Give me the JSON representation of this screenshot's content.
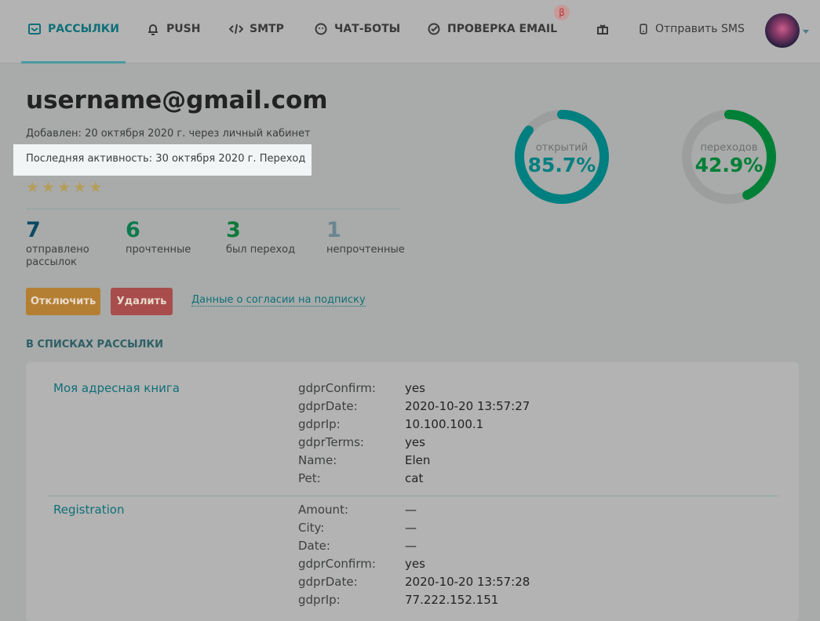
{
  "nav": {
    "items": [
      {
        "label": "РАССЫЛКИ",
        "icon": "envelope-icon"
      },
      {
        "label": "PUSH",
        "icon": "bell-icon"
      },
      {
        "label": "SMTP",
        "icon": "code-icon"
      },
      {
        "label": "ЧАТ-БОТЫ",
        "icon": "chat-icon"
      },
      {
        "label": "ПРОВЕРКА EMAIL",
        "icon": "check-circle-icon"
      }
    ],
    "beta": "β",
    "gift_icon": "gift-icon",
    "sms_label": "Отправить SMS",
    "sms_icon": "phone-icon"
  },
  "contact": {
    "email": "username@gmail.com",
    "added": "Добавлен: 20 октября 2020 г. через личный кабинет",
    "last_activity": "Последняя активность: 30 октября 2020 г. Переход",
    "rating": 5
  },
  "stats": [
    {
      "value": "7",
      "label": "отправлено рассылок",
      "color": "#0d4a63"
    },
    {
      "value": "6",
      "label": "прочтенные",
      "color": "#0c7a4e"
    },
    {
      "value": "3",
      "label": "был переход",
      "color": "#0b7a3a"
    },
    {
      "value": "1",
      "label": "непрочтенные",
      "color": "#6a8590"
    }
  ],
  "actions": {
    "disable": "Отключить",
    "delete": "Удалить",
    "consent_link": "Данные о согласии на подписку"
  },
  "donuts": [
    {
      "label": "открытий",
      "value": "85.7%",
      "percent": 85.7,
      "color": "#007f80"
    },
    {
      "label": "переходов",
      "value": "42.9%",
      "percent": 42.9,
      "color": "#007f36"
    }
  ],
  "lists_section": {
    "title": "В СПИСКАХ РАССЫЛКИ",
    "lists": [
      {
        "name": "Моя адресная книга",
        "fields": [
          [
            "gdprConfirm:",
            "yes"
          ],
          [
            "gdprDate:",
            "2020-10-20 13:57:27"
          ],
          [
            "gdprIp:",
            "10.100.100.1"
          ],
          [
            "gdprTerms:",
            "yes"
          ],
          [
            "Name:",
            "Elen"
          ],
          [
            "Pet:",
            "cat"
          ]
        ]
      },
      {
        "name": "Registration",
        "fields": [
          [
            "Amount:",
            "—"
          ],
          [
            "City:",
            "—"
          ],
          [
            "Date:",
            "—"
          ],
          [
            "gdprConfirm:",
            "yes"
          ],
          [
            "gdprDate:",
            "2020-10-20 13:57:28"
          ],
          [
            "gdprIp:",
            "77.222.152.151"
          ]
        ]
      }
    ]
  }
}
